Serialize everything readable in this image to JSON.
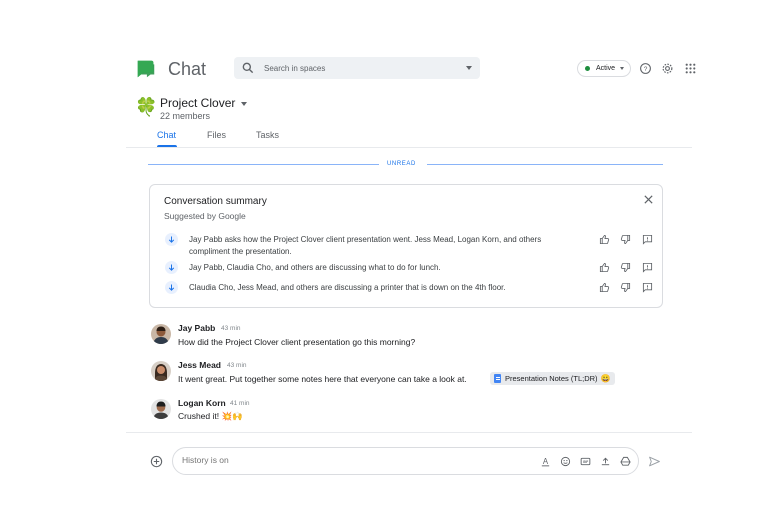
{
  "header": {
    "app_title": "Chat",
    "search_placeholder": "Search in spaces",
    "status_label": "Active"
  },
  "space": {
    "name": "Project Clover",
    "icon": "🍀",
    "members": "22 members",
    "tabs": [
      "Chat",
      "Files",
      "Tasks"
    ],
    "active_tab": "Chat"
  },
  "unread_label": "UNREAD",
  "summary": {
    "title": "Conversation summary",
    "subtitle": "Suggested by Google",
    "items": [
      {
        "text": "Jay Pabb asks how the Project Clover client presentation went. Jess Mead, Logan Korn, and others compliment the presentation."
      },
      {
        "text": "Jay Pabb, Claudia Cho, and others are discussing what to do for lunch."
      },
      {
        "text": "Claudia Cho, Jess Mead, and others are discussing a printer that is down on the 4th floor."
      }
    ]
  },
  "messages": [
    {
      "name": "Jay Pabb",
      "time": "43 min",
      "text": "How did the Project Clover client presentation go this morning?"
    },
    {
      "name": "Jess Mead",
      "time": "43 min",
      "text": "It went great. Put together some notes here that everyone can take a look at.",
      "chip": "Presentation Notes (TL;DR)",
      "chip_emoji": "😀"
    },
    {
      "name": "Logan Korn",
      "time": "41 min",
      "text": "Crushed it! 💥🙌"
    }
  ],
  "compose": {
    "placeholder": "History is on"
  },
  "colors": {
    "accent": "#1a73e8",
    "active_green": "#1e8e3e",
    "logo_green": "#34a853"
  }
}
